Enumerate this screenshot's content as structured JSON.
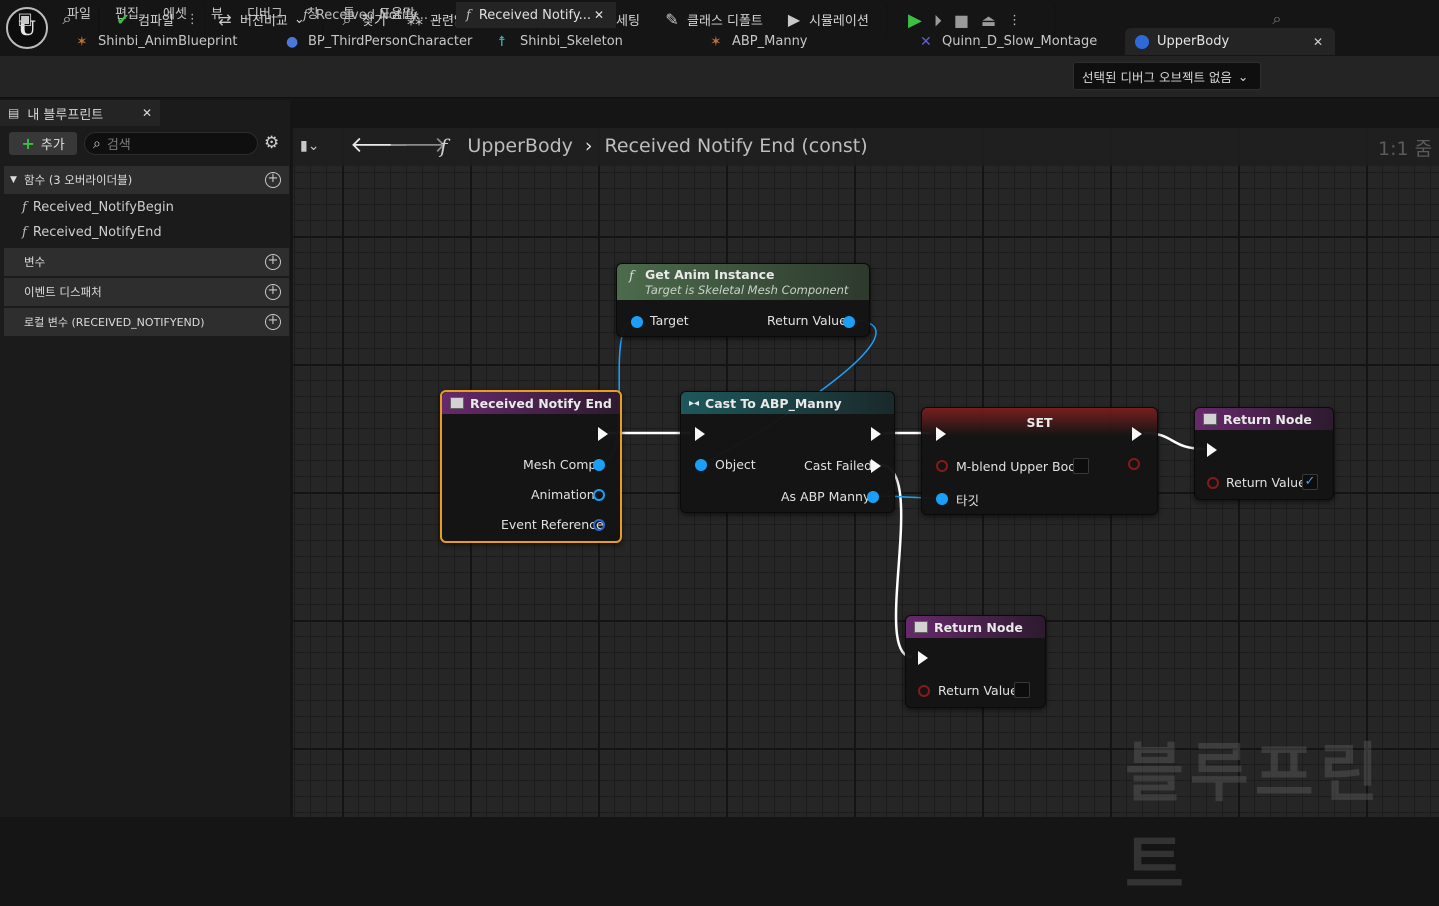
{
  "menu": [
    "파일",
    "편집",
    "에셋",
    "뷰",
    "디버그",
    "창",
    "툴",
    "도움말"
  ],
  "doc_tabs": [
    {
      "label": "Shinbi_AnimBlueprint"
    },
    {
      "label": "BP_ThirdPersonCharacter"
    },
    {
      "label": "Shinbi_Skeleton"
    },
    {
      "label": "ABP_Manny"
    },
    {
      "label": "Quinn_D_Slow_Montage"
    },
    {
      "label": "UpperBody",
      "close": "✕"
    }
  ],
  "toolbar": {
    "compile": "컴파일",
    "diff": "버전비교",
    "find": "찾기",
    "hide_unrelated": "관련없음 숨김",
    "class_settings": "클래스 세팅",
    "class_defaults": "클래스 디폴트",
    "simulation": "시뮬레이션",
    "debug_object": "선택된 디버그 오브젝트 없음"
  },
  "left_panel": {
    "tab_label": "내 블루프린트",
    "tab_close": "✕",
    "add_label": "추가",
    "search_placeholder": "검색",
    "sections": {
      "functions": "함수 (3 오버라이더블)",
      "variables": "변수",
      "event_dispatchers": "이벤트 디스패처",
      "local_vars": "로컬 변수 (RECEIVED_NOTIFYEND)"
    },
    "functions": [
      "Received_NotifyBegin",
      "Received_NotifyEnd"
    ]
  },
  "graph_tabs": [
    "Received Notify...",
    "Received Notify..."
  ],
  "breadcrumb": {
    "root": "UpperBody",
    "current": "Received Notify End (const)"
  },
  "zoom": "1:1 줌",
  "watermark": "블루프린트",
  "nodes": {
    "get_anim": {
      "title": "Get Anim Instance",
      "subtitle": "Target is Skeletal Mesh Component",
      "in": "Target",
      "out": "Return Value"
    },
    "notify_end": {
      "title": "Received Notify End",
      "pins": [
        "Mesh Comp",
        "Animation",
        "Event Reference"
      ]
    },
    "cast": {
      "title": "Cast To ABP_Manny",
      "object": "Object",
      "failed": "Cast Failed",
      "as": "As ABP Manny"
    },
    "set": {
      "title": "SET",
      "var": "M-blend Upper Body",
      "target": "타깃"
    },
    "return1": {
      "title": "Return Node",
      "value": "Return Value"
    },
    "return2": {
      "title": "Return Node",
      "value": "Return Value"
    }
  },
  "colors": {
    "accent_orange": "#f0a020",
    "function_header": "#6a2a6e",
    "cast_header": "#1e5a5e",
    "pure_header": "#4e6e4e",
    "set_header": "#7a1e1e"
  }
}
